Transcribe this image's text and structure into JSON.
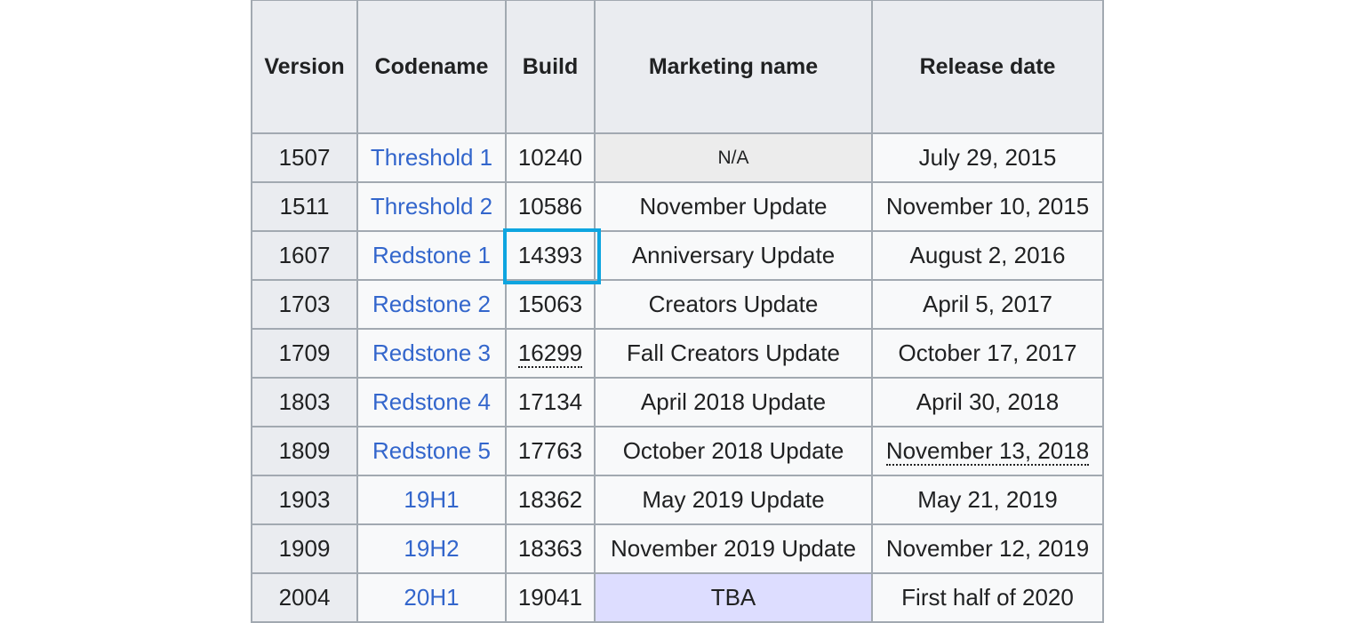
{
  "table": {
    "headers": {
      "version": "Version",
      "codename": "Codename",
      "build": "Build",
      "marketing_name": "Marketing name",
      "release_date": "Release date"
    },
    "rows": [
      {
        "version": "1507",
        "codename": "Threshold 1",
        "build": "10240",
        "marketing_name": "N/A",
        "release_date": "July 29, 2015"
      },
      {
        "version": "1511",
        "codename": "Threshold 2",
        "build": "10586",
        "marketing_name": "November Update",
        "release_date": "November 10, 2015"
      },
      {
        "version": "1607",
        "codename": "Redstone 1",
        "build": "14393",
        "marketing_name": "Anniversary Update",
        "release_date": "August 2, 2016"
      },
      {
        "version": "1703",
        "codename": "Redstone 2",
        "build": "15063",
        "marketing_name": "Creators Update",
        "release_date": "April 5, 2017"
      },
      {
        "version": "1709",
        "codename": "Redstone 3",
        "build": "16299",
        "marketing_name": "Fall Creators Update",
        "release_date": "October 17, 2017"
      },
      {
        "version": "1803",
        "codename": "Redstone 4",
        "build": "17134",
        "marketing_name": "April 2018 Update",
        "release_date": "April 30, 2018"
      },
      {
        "version": "1809",
        "codename": "Redstone 5",
        "build": "17763",
        "marketing_name": "October 2018 Update",
        "release_date": "November 13, 2018"
      },
      {
        "version": "1903",
        "codename": "19H1",
        "build": "18362",
        "marketing_name": "May 2019 Update",
        "release_date": "May 21, 2019"
      },
      {
        "version": "1909",
        "codename": "19H2",
        "build": "18363",
        "marketing_name": "November 2019 Update",
        "release_date": "November 12, 2019"
      },
      {
        "version": "2004",
        "codename": "20H1",
        "build": "19041",
        "marketing_name": "TBA",
        "release_date": "First half of 2020"
      }
    ]
  },
  "colors": {
    "link": "#3366cc",
    "header_bg": "#eaecf0",
    "cell_bg": "#f8f9fa",
    "na_bg": "#ececec",
    "tba_bg": "#ddddff",
    "highlight": "#0ea5e0"
  }
}
